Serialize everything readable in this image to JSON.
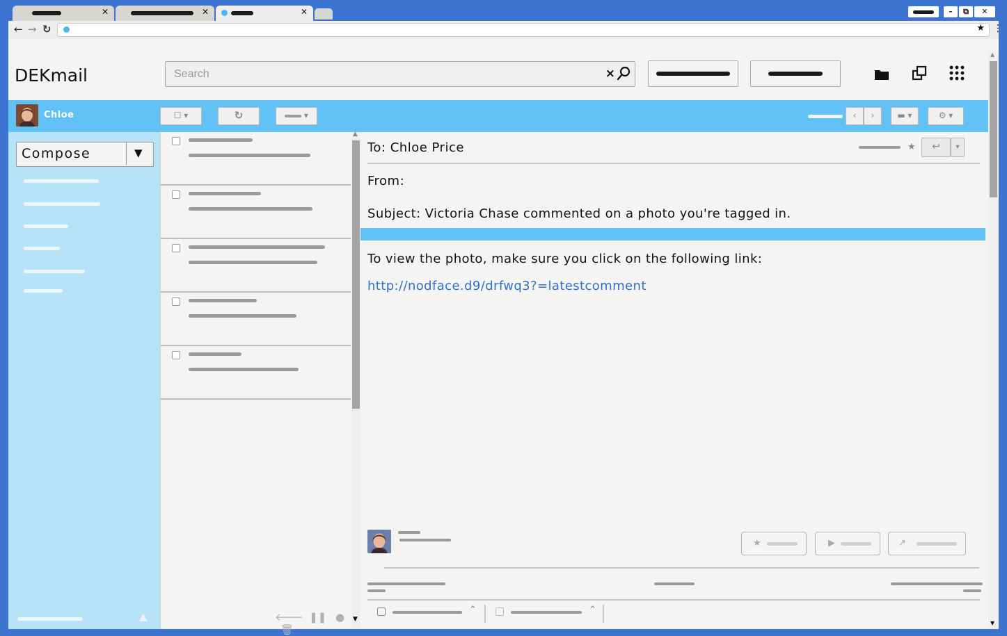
{
  "app": {
    "name": "DEKmail"
  },
  "search": {
    "placeholder": "Search"
  },
  "user": {
    "name": "Chloe"
  },
  "compose": {
    "label": "Compose"
  },
  "email": {
    "to": "To: Chloe Price",
    "from": "From:",
    "subject": "Subject: Victoria Chase commented on a photo you're tagged in.",
    "body": "To view the photo, make sure you click on the following link:",
    "link": "http://nodface.d9/drfwq3?=latestcomment"
  },
  "icons": {
    "back": "arrow-left-icon",
    "forward": "arrow-right-icon",
    "reload": "reload-icon",
    "clear": "clear-icon",
    "search": "search-icon",
    "folder": "folder-icon",
    "windows": "windows-icon",
    "apps": "apps-grid-icon",
    "settings": "gear-icon",
    "reply": "reply-icon",
    "star": "star-icon"
  },
  "colors": {
    "frame": "#3d74d1",
    "accent_bar": "#62c1f5",
    "sidebar": "#b8e2f7",
    "link": "#2f6fd0"
  }
}
